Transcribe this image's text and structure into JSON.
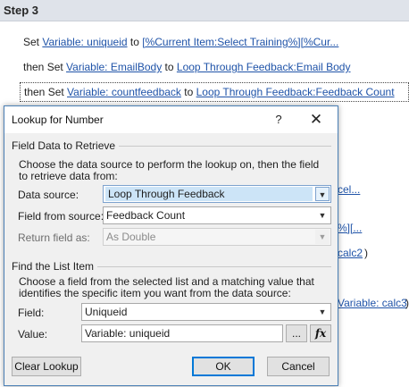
{
  "step": {
    "title": "Step 3"
  },
  "workflow": {
    "lines": [
      {
        "prefix": "Set ",
        "var": "Variable: uniqueid",
        "mid": " to ",
        "target": "[%Current Item:Select Training%][%Cur..."
      },
      {
        "prefix": "then Set ",
        "var": "Variable: EmailBody",
        "mid": " to ",
        "target": "Loop Through Feedback:Email Body"
      },
      {
        "prefix": "then Set ",
        "var": "Variable: countfeedback",
        "mid": " to ",
        "target": "Loop Through Feedback:Feedback Count"
      }
    ],
    "fragments": [
      "cel...",
      "%][...",
      "calc2",
      ")",
      "Variable: calc3",
      ")"
    ]
  },
  "dialog": {
    "title": "Lookup for Number",
    "help_glyph": "?",
    "close_glyph": "✕",
    "section1": {
      "label": "Field Data to Retrieve",
      "description": "Choose the data source to perform the lookup on, then the field to retrieve data from:",
      "data_source_label": "Data source:",
      "data_source_value": "Loop Through Feedback",
      "field_from_source_label": "Field from source:",
      "field_from_source_value": "Feedback Count",
      "return_field_label": "Return field as:",
      "return_field_value": "As Double"
    },
    "section2": {
      "label": "Find the List Item",
      "description": "Choose a field from the selected list and a matching value that identifies the specific item you want from the data source:",
      "field_label": "Field:",
      "field_value": "Uniqueid",
      "value_label": "Value:",
      "value_value": "Variable: uniqueid",
      "browse_label": "...",
      "fx_label": "fx"
    },
    "buttons": {
      "clear_lookup": "Clear Lookup",
      "ok": "OK",
      "cancel": "Cancel"
    }
  },
  "icons": {
    "dropdown": "chevron-down-icon",
    "close": "close-icon",
    "help": "help-icon"
  },
  "colors": {
    "link": "#1f53a8",
    "selection": "#cce4f7",
    "default_button_border": "#0078d7"
  }
}
